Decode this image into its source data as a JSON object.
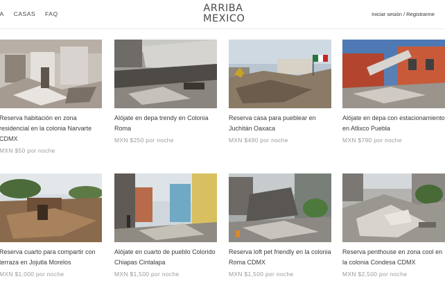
{
  "nav": {
    "items": [
      {
        "label": "VA"
      },
      {
        "label": "CASAS"
      },
      {
        "label": "FAQ"
      }
    ]
  },
  "logo": {
    "line1": "ARRIBA",
    "line2": "MEXICO"
  },
  "account": {
    "login_label": "Iniciar sesión / Registrarme"
  },
  "listings": [
    {
      "title": "Reserva habitación en zona residencial en la colonia Narvarte CDMX",
      "price": "MXN $50 por noche",
      "photo_icon": "earthquake-rubble-photo"
    },
    {
      "title": "Alójate en depa trendy en Colonia Roma",
      "price": "MXN $250 por noche",
      "photo_icon": "collapsed-building-photo"
    },
    {
      "title": "Reserva casa para pueblear en Juchitán Oaxaca",
      "price": "MXN $490 por noche",
      "photo_icon": "rubble-flag-photo"
    },
    {
      "title": "Alójate en depa con estacionamiento en Atlixco Puebla",
      "price": "MXN $790 por noche",
      "photo_icon": "damaged-house-photo"
    },
    {
      "title": "Reserva cuarto para compartir con terraza en Jojutla Morelos",
      "price": "MXN $1,000 por noche",
      "photo_icon": "destroyed-house-photo"
    },
    {
      "title": "Alójate en cuarto de pueblo Colorido Chiapas Cintalapa",
      "price": "MXN $1,500 por noche",
      "photo_icon": "damaged-street-photo"
    },
    {
      "title": "Reserva loft pet friendly en la colonia Roma CDMX",
      "price": "MXN $1,500 por noche",
      "photo_icon": "collapsed-building-photo"
    },
    {
      "title": "Reserva penthouse en zona cool en la colonia Condesa CDMX",
      "price": "MXN $2,500 por noche",
      "photo_icon": "rubble-pile-photo"
    }
  ]
}
